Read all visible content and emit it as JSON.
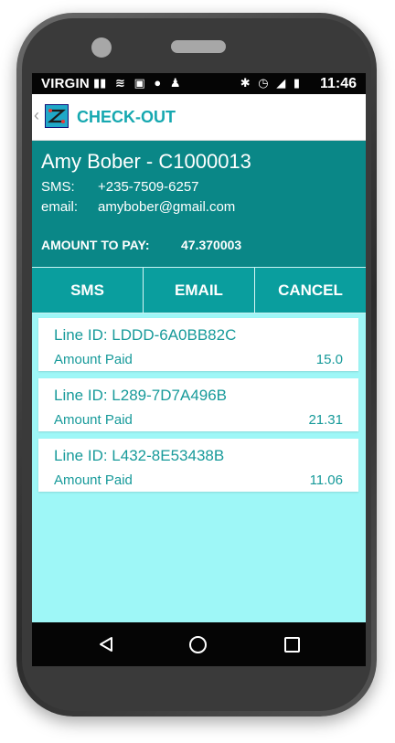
{
  "status_bar": {
    "carrier": "VIRGIN",
    "time": "11:46",
    "left_icons": [
      "signal-bars-icon",
      "wifi-icon",
      "image-icon",
      "message-icon",
      "android-icon"
    ],
    "right_icons": [
      "bluetooth-icon",
      "alarm-icon",
      "h-signal-icon",
      "battery-icon"
    ]
  },
  "app_bar": {
    "title": "CHECK-OUT"
  },
  "customer": {
    "name": "Amy Bober - C1000013",
    "sms_label": "SMS:",
    "sms_value": "+235-7509-6257",
    "email_label": "email:",
    "email_value": "amybober@gmail.com",
    "amount_label": "AMOUNT TO PAY:",
    "amount_value": "47.370003"
  },
  "actions": {
    "sms": "SMS",
    "email": "EMAIL",
    "cancel": "CANCEL"
  },
  "lines": [
    {
      "id": "Line ID: LDDD-6A0BB82C",
      "label": "Amount Paid",
      "amount": "15.0"
    },
    {
      "id": "Line ID: L289-7D7A496B",
      "label": "Amount Paid",
      "amount": "21.31"
    },
    {
      "id": "Line ID: L432-8E53438B",
      "label": "Amount Paid",
      "amount": "11.06"
    }
  ],
  "colors": {
    "teal_dark": "#0a8787",
    "teal_button": "#0a9e9e",
    "list_bg": "#9ef7f7",
    "text_teal": "#179a9a"
  }
}
